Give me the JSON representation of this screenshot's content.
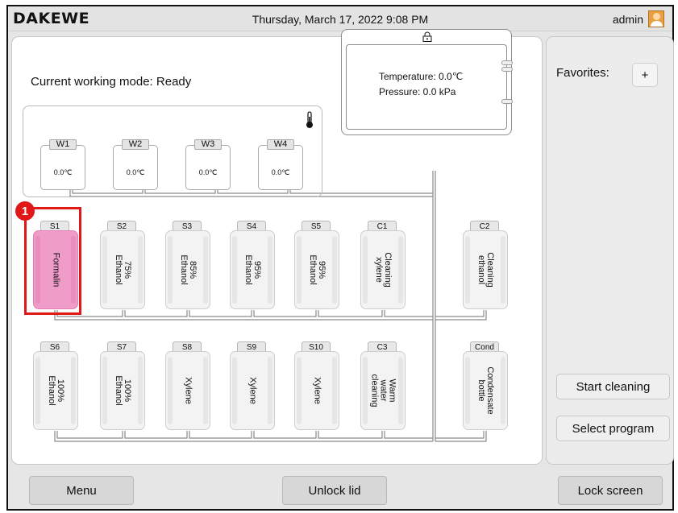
{
  "header": {
    "logo": "DAKEWE",
    "datetime": "Thursday, March 17, 2022 9:08 PM",
    "user": "admin"
  },
  "status": {
    "mode_label": "Current working mode:  Ready"
  },
  "wax_baths": [
    {
      "id": "W1",
      "temp": "0.0℃"
    },
    {
      "id": "W2",
      "temp": "0.0℃"
    },
    {
      "id": "W3",
      "temp": "0.0℃"
    },
    {
      "id": "W4",
      "temp": "0.0℃"
    }
  ],
  "retort": {
    "temperature": "Temperature:  0.0℃",
    "pressure": "Pressure:  0.0 kPa"
  },
  "row1": [
    {
      "id": "S1",
      "label": "Formalin",
      "color": "#f09cc8"
    },
    {
      "id": "S2",
      "label": "75% Ethanol"
    },
    {
      "id": "S3",
      "label": "85% Ethanol"
    },
    {
      "id": "S4",
      "label": "95% Ethanol"
    },
    {
      "id": "S5",
      "label": "95% Ethanol"
    },
    {
      "id": "C1",
      "label": "Cleaning\nxylene"
    },
    {
      "id": "C2",
      "label": "Cleaning\nethanol"
    }
  ],
  "row2": [
    {
      "id": "S6",
      "label": "100% Ethanol"
    },
    {
      "id": "S7",
      "label": "100% Ethanol"
    },
    {
      "id": "S8",
      "label": "Xylene"
    },
    {
      "id": "S9",
      "label": "Xylene"
    },
    {
      "id": "S10",
      "label": "Xylene"
    },
    {
      "id": "C3",
      "label": "Warm water\ncleaning"
    },
    {
      "id": "Cond",
      "label": "Condensate\nbottle"
    }
  ],
  "annotation": {
    "badge": "1"
  },
  "side": {
    "favorites_label": "Favorites:",
    "add_label": "+",
    "start_cleaning": "Start cleaning",
    "select_program": "Select program"
  },
  "footer": {
    "menu": "Menu",
    "unlock_lid": "Unlock lid",
    "lock_screen": "Lock screen"
  },
  "colors": {
    "highlight": "#e01818",
    "formalin": "#f09cc8"
  }
}
